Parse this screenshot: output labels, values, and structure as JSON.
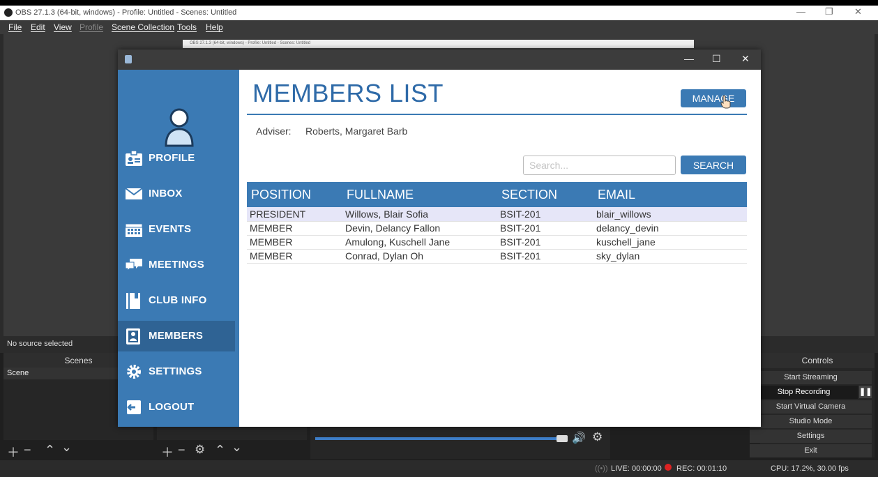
{
  "obs": {
    "title": "OBS 27.1.3 (64-bit, windows) - Profile: Untitled - Scenes: Untitled",
    "menu": [
      "File",
      "Edit",
      "View",
      "Profile",
      "Scene Collection",
      "Tools",
      "Help"
    ],
    "captured_window_title": "OBS 27.1.3 (64-bit, windows) - Profile: Untitled - Scenes: Untitled",
    "no_source": "No source selected",
    "scenes_header": "Scenes",
    "scene_item": "Scene",
    "controls_header": "Controls",
    "controls": [
      "Start Streaming",
      "Stop Recording",
      "Start Virtual Camera",
      "Studio Mode",
      "Settings",
      "Exit"
    ],
    "status": {
      "live": "LIVE: 00:00:00",
      "rec": "REC: 00:01:10",
      "cpu": "CPU: 17.2%, 30.00 fps"
    }
  },
  "app": {
    "window_controls": [
      "—",
      "☐",
      "✕"
    ],
    "nav": [
      {
        "label": "PROFILE",
        "icon": "id-card-icon"
      },
      {
        "label": "INBOX",
        "icon": "envelope-icon"
      },
      {
        "label": "EVENTS",
        "icon": "calendar-icon"
      },
      {
        "label": "MEETINGS",
        "icon": "chat-bubbles-icon"
      },
      {
        "label": "CLUB INFO",
        "icon": "book-icon"
      },
      {
        "label": "MEMBERS",
        "icon": "contacts-icon"
      },
      {
        "label": "SETTINGS",
        "icon": "gear-icon"
      },
      {
        "label": "LOGOUT",
        "icon": "logout-icon"
      }
    ],
    "active_nav": "MEMBERS",
    "page_title": "MEMBERS LIST",
    "manage_label": "MANAGE",
    "adviser_label": "Adviser:",
    "adviser_name": "Roberts, Margaret Barb",
    "search_placeholder": "Search...",
    "search_label": "SEARCH",
    "table": {
      "columns": [
        "POSITION",
        "FULLNAME",
        "SECTION",
        "EMAIL"
      ],
      "rows": [
        [
          "PRESIDENT",
          "Willows, Blair Sofia",
          "BSIT-201",
          "blair_willows"
        ],
        [
          "MEMBER",
          "Devin, Delancy Fallon",
          "BSIT-201",
          "delancy_devin"
        ],
        [
          "MEMBER",
          "Amulong, Kuschell Jane",
          "BSIT-201",
          "kuschell_jane"
        ],
        [
          "MEMBER",
          "Conrad, Dylan Oh",
          "BSIT-201",
          "sky_dylan"
        ]
      ]
    },
    "colors": {
      "accent": "#3b7ab4",
      "title": "#2e6aa8",
      "selected_row": "#e6e6f8"
    }
  }
}
